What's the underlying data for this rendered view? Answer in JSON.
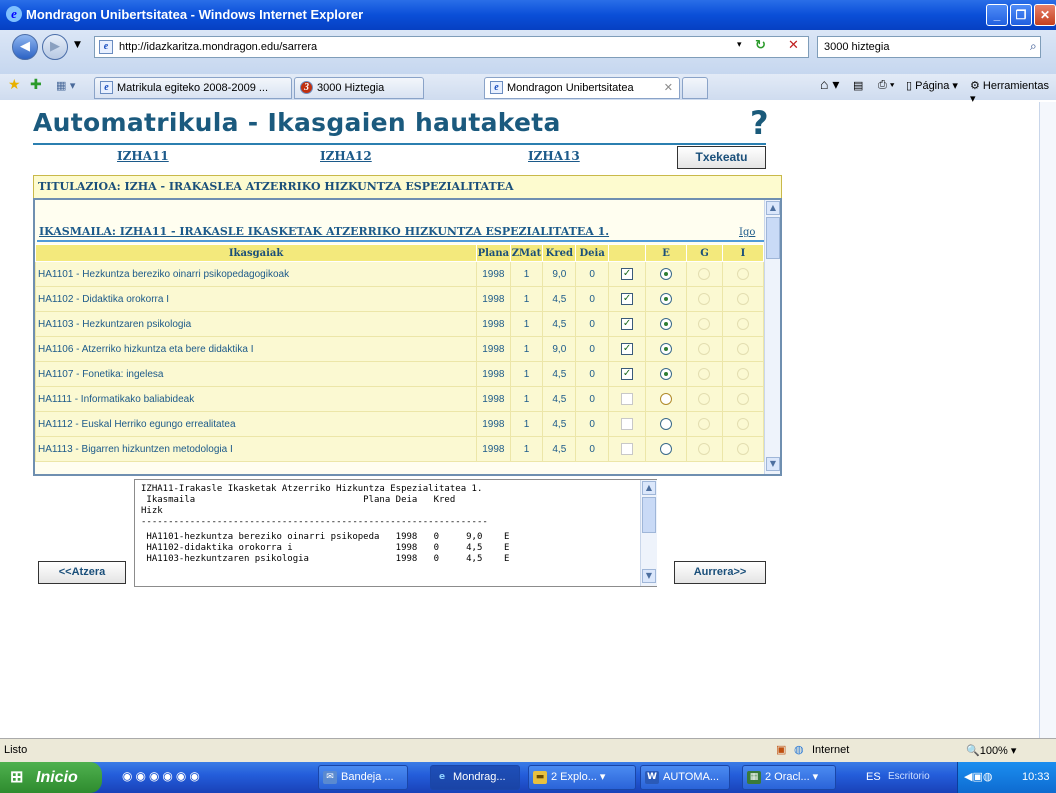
{
  "window": {
    "title": "Mondragon Unibertsitatea - Windows Internet Explorer"
  },
  "browser": {
    "url": "http://idazkaritza.mondragon.edu/sarrera",
    "search_value": "3000 hiztegia",
    "tabs": [
      {
        "label": "Matrikula egiteko 2008-2009 ..."
      },
      {
        "label": "3000 Hiztegia"
      },
      {
        "label": "Mondragon Unibertsitatea"
      }
    ],
    "toolbar": {
      "pagina": "Página",
      "herramientas": "Herramientas"
    }
  },
  "page": {
    "title": "Automatrikula - Ikasgaien hautaketa",
    "help": "?",
    "groups": [
      "IZHA11",
      "IZHA12",
      "IZHA13"
    ],
    "txekeatu": "Txekeatu",
    "titulazioa": "TITULAZIOA: IZHA - IRAKASLEA ATZERRIKO HIZKUNTZA ESPEZIALITATEA",
    "ikasmaila": "IKASMAILA: IZHA11 - IRAKASLE IKASKETAK ATZERRIKO HIZKUNTZA ESPEZIALITATEA 1.",
    "igo": "Igo",
    "columns": [
      "Ikasgaiak",
      "Plana",
      "ZMat",
      "Kred",
      "Deia",
      "",
      "E",
      "G",
      "I"
    ],
    "rows": [
      {
        "name": "HA1101 - Hezkuntza bereziko oinarri psikopedagogikoak",
        "plana": "1998",
        "zmat": "1",
        "kred": "9,0",
        "deia": "0",
        "checked": true,
        "e": "selected"
      },
      {
        "name": "HA1102 - Didaktika orokorra I",
        "plana": "1998",
        "zmat": "1",
        "kred": "4,5",
        "deia": "0",
        "checked": true,
        "e": "selected"
      },
      {
        "name": "HA1103 - Hezkuntzaren psikologia",
        "plana": "1998",
        "zmat": "1",
        "kred": "4,5",
        "deia": "0",
        "checked": true,
        "e": "selected"
      },
      {
        "name": "HA1106 - Atzerriko hizkuntza eta bere didaktika I",
        "plana": "1998",
        "zmat": "1",
        "kred": "9,0",
        "deia": "0",
        "checked": true,
        "e": "selected"
      },
      {
        "name": "HA1107 - Fonetika: ingelesa",
        "plana": "1998",
        "zmat": "1",
        "kred": "4,5",
        "deia": "0",
        "checked": true,
        "e": "selected"
      },
      {
        "name": "HA1111 - Informatikako baliabideak",
        "plana": "1998",
        "zmat": "1",
        "kred": "4,5",
        "deia": "0",
        "checked": false,
        "e": "hover"
      },
      {
        "name": "HA1112 - Euskal Herriko egungo errealitatea",
        "plana": "1998",
        "zmat": "1",
        "kred": "4,5",
        "deia": "0",
        "checked": false,
        "e": "empty"
      },
      {
        "name": "HA1113 - Bigarren hizkuntzen metodologia I",
        "plana": "1998",
        "zmat": "1",
        "kred": "4,5",
        "deia": "0",
        "checked": false,
        "e": "empty"
      }
    ],
    "summary_lines": [
      "IZHA11-Irakasle Ikasketak Atzerriko Hizkuntza Espezialitatea 1.",
      " Ikasmaila                               Plana Deia   Kred",
      "Hizk",
      "----------------------------------------------------------------",
      " HA1101-hezkuntza bereziko oinarri psikopeda   1998   0     9,0    E",
      " HA1102-didaktika orokorra i                   1998   0     4,5    E",
      " HA1103-hezkuntzaren psikologia                1998   0     4,5    E"
    ],
    "atzera": "<<Atzera",
    "aurrera": "Aurrera>>"
  },
  "statusbar": {
    "text": "Listo",
    "zone": "Internet",
    "zoom": "100%"
  },
  "taskbar": {
    "start": "Inicio",
    "items": [
      "Bandeja ...",
      "Mondrag...",
      "2 Explo...",
      "AUTOMA...",
      "2 Oracl..."
    ],
    "lang": "ES",
    "desktop": "Escritorio",
    "clock": "10:33"
  }
}
